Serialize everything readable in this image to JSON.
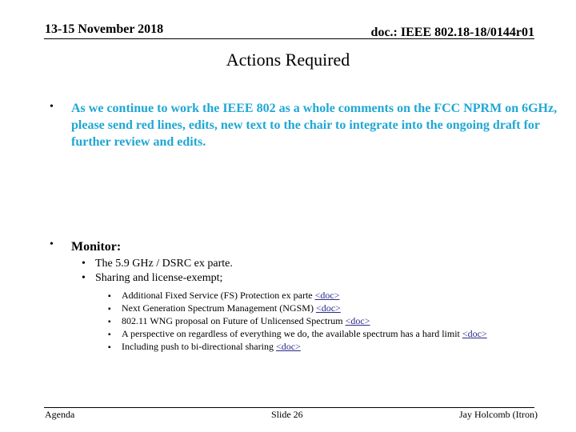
{
  "header": {
    "date": "13-15 November 2018",
    "doc": "doc.: IEEE 802.18-18/0144r01"
  },
  "title": "Actions Required",
  "colors": {
    "highlight_text": "#1fa7d4",
    "link": "#2a2a8a"
  },
  "bullets": [
    {
      "marker": "•",
      "text": "As we continue to work the IEEE 802 as a whole comments on the FCC NPRM on 6GHz, please send red lines, edits, new text to the chair to integrate into the ongoing draft for further review and edits."
    },
    {
      "marker": "•",
      "text": "Monitor:",
      "sub_items": [
        {
          "marker": "•",
          "text": "The 5.9 GHz / DSRC ex parte."
        },
        {
          "marker": "•",
          "text": "Sharing and license-exempt;"
        }
      ],
      "sub_sub_items": [
        {
          "marker": "▪",
          "text": "Additional Fixed Service (FS) Protection ex parte ",
          "link": "<doc>"
        },
        {
          "marker": "▪",
          "text": "Next Generation Spectrum Management (NGSM) ",
          "link": "<doc>"
        },
        {
          "marker": "▪",
          "text": "802.11 WNG proposal on Future of Unlicensed Spectrum ",
          "link": "<doc>"
        },
        {
          "marker": "▪",
          "text": "A perspective on regardless of everything we do, the available spectrum has a hard limit ",
          "link": "<doc>"
        },
        {
          "marker": "▪",
          "text": "Including push to bi-directional sharing ",
          "link": "<doc>"
        }
      ]
    }
  ],
  "footer": {
    "left": "Agenda",
    "center": "Slide 26",
    "right": "Jay Holcomb (Itron)"
  }
}
